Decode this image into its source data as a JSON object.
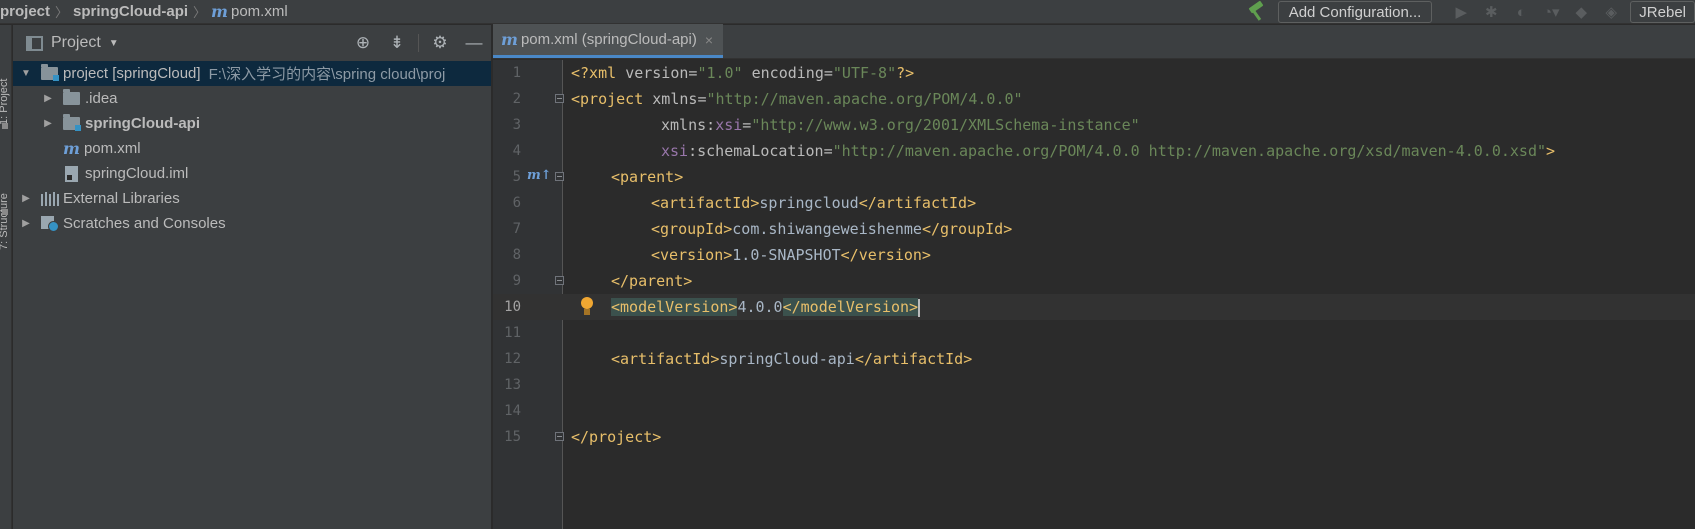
{
  "breadcrumbs": [
    {
      "label": "project",
      "bold": true
    },
    {
      "label": "springCloud-api",
      "bold": true
    },
    {
      "label": "pom.xml",
      "icon": "maven-icon"
    }
  ],
  "toolbar": {
    "add_configuration": "Add Configuration...",
    "jrebel": "JRebel"
  },
  "side_tabs": [
    "1: Project",
    "7: Structure"
  ],
  "project_panel": {
    "title": "Project",
    "tree": [
      {
        "label": "project [springCloud]",
        "path": "F:\\深入学习的内容\\spring cloud\\proj",
        "depth": 0,
        "expanded": true,
        "selected": true,
        "icon": "module-folder-icon"
      },
      {
        "label": ".idea",
        "depth": 1,
        "collapsed": true,
        "icon": "folder-icon"
      },
      {
        "label": "springCloud-api",
        "depth": 1,
        "collapsed": true,
        "bold": true,
        "icon": "module-folder-icon"
      },
      {
        "label": "pom.xml",
        "depth": 1,
        "icon": "maven-icon"
      },
      {
        "label": "springCloud.iml",
        "depth": 1,
        "icon": "iml-file-icon"
      },
      {
        "label": "External Libraries",
        "depth": 0,
        "collapsed": true,
        "icon": "library-icon"
      },
      {
        "label": "Scratches and Consoles",
        "depth": 0,
        "collapsed": true,
        "icon": "scratch-icon"
      }
    ]
  },
  "editor": {
    "tab_label": "pom.xml (springCloud-api)",
    "current_line": 10,
    "lines": [
      "1",
      "2",
      "3",
      "4",
      "5",
      "6",
      "7",
      "8",
      "9",
      "10",
      "11",
      "12",
      "13",
      "14",
      "15"
    ],
    "code": {
      "l1_decl_open": "<?xml ",
      "l1_a1": "version",
      "l1_v1": "\"1.0\"",
      "l1_a2": " encoding",
      "l1_v2": "\"UTF-8\"",
      "l1_close": "?>",
      "l2_tag": "<project ",
      "l2_attr": "xmlns",
      "l2_val": "\"http://maven.apache.org/POM/4.0.0\"",
      "l3_attr": "xmlns:",
      "l3_ns": "xsi",
      "l3_val": "\"http://www.w3.org/2001/XMLSchema-instance\"",
      "l4_ns": "xsi",
      "l4_attr": ":schemaLocation",
      "l4_val": "\"http://maven.apache.org/POM/4.0.0 http://maven.apache.org/xsd/maven-4.0.0.xsd\"",
      "l4_close": ">",
      "l5": "<parent>",
      "l6_open": "<artifactId>",
      "l6_text": "springcloud",
      "l6_close": "</artifactId>",
      "l7_open": "<groupId>",
      "l7_text": "com.shiwangeweishenme",
      "l7_close": "</groupId>",
      "l8_open": "<version>",
      "l8_text": "1.0-SNAPSHOT",
      "l8_close": "</version>",
      "l9": "</parent>",
      "l10_open": "<modelVersion>",
      "l10_text": "4.0.0",
      "l10_close": "</modelVersion>",
      "l12_open": "<artifactId>",
      "l12_text": "springCloud-api",
      "l12_close": "</artifactId>",
      "l15": "</project>"
    }
  }
}
